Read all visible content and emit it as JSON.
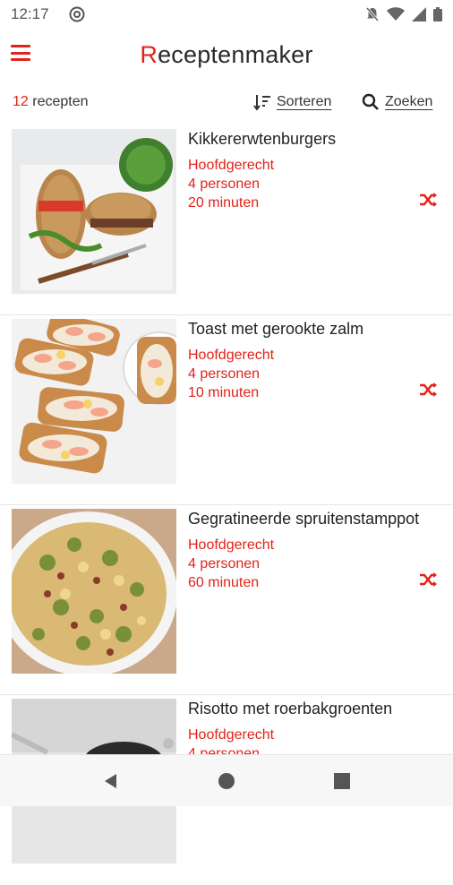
{
  "status": {
    "time": "12:17"
  },
  "app": {
    "title_first": "R",
    "title_rest": "eceptenmaker"
  },
  "toolbar": {
    "count_num": "12",
    "count_label": "recepten",
    "sort_label": "Sorteren",
    "search_label": "Zoeken"
  },
  "recipes": [
    {
      "title": "Kikkererwtenburgers",
      "category": "Hoofdgerecht",
      "persons": "4 personen",
      "time": "20 minuten"
    },
    {
      "title": "Toast met gerookte zalm",
      "category": "Hoofdgerecht",
      "persons": "4 personen",
      "time": "10 minuten"
    },
    {
      "title": "Gegratineerde spruitenstamppot",
      "category": "Hoofdgerecht",
      "persons": "4 personen",
      "time": "60 minuten"
    },
    {
      "title": "Risotto met roerbakgroenten",
      "category": "Hoofdgerecht",
      "persons": "4 personen",
      "time": ""
    }
  ],
  "colors": {
    "accent": "#e2231a"
  }
}
